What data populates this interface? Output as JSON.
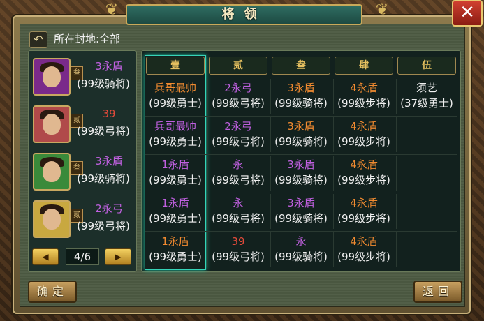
{
  "window": {
    "title": "将领",
    "close_label": "✕"
  },
  "fief": {
    "label": "所在封地:全部"
  },
  "back_arrow": "↶",
  "colors": {
    "purple": "#c060e0",
    "red": "#e04a3a",
    "orange": "#f08a30",
    "gold": "#e6c060",
    "white": "#f0f0f0"
  },
  "generals": [
    {
      "rank": "叁",
      "troops": "3永盾",
      "troops_color": "#c060e0",
      "level": "(99级骑将)",
      "portrait_bg": "#7a2a8a"
    },
    {
      "rank": "贰",
      "troops": "39",
      "troops_color": "#e04a3a",
      "level": "(99级弓将)",
      "portrait_bg": "#b04a4a"
    },
    {
      "rank": "叁",
      "troops": "3永盾",
      "troops_color": "#c060e0",
      "level": "(99级骑将)",
      "portrait_bg": "#3a8a3a"
    },
    {
      "rank": "贰",
      "troops": "2永弓",
      "troops_color": "#c060e0",
      "level": "(99级弓将)",
      "portrait_bg": "#c8a840"
    }
  ],
  "pager": {
    "prev": "◀",
    "next": "▶",
    "text": "4/6"
  },
  "columns": [
    "壹",
    "贰",
    "叁",
    "肆",
    "伍"
  ],
  "grid": [
    [
      {
        "t": "兵哥最帅",
        "c": "#f08a30",
        "l": "(99级勇士)"
      },
      {
        "t": "2永弓",
        "c": "#c060e0",
        "l": "(99级弓将)"
      },
      {
        "t": "3永盾",
        "c": "#f08a30",
        "l": "(99级骑将)"
      },
      {
        "t": "4永盾",
        "c": "#f08a30",
        "l": "(99级步将)"
      },
      {
        "t": "须艺",
        "c": "#f0f0f0",
        "l": "(37级勇士)"
      }
    ],
    [
      {
        "t": "兵哥最帅",
        "c": "#c060e0",
        "l": "(99级勇士)"
      },
      {
        "t": "2永弓",
        "c": "#c060e0",
        "l": "(99级弓将)"
      },
      {
        "t": "3永盾",
        "c": "#f08a30",
        "l": "(99级骑将)"
      },
      {
        "t": "4永盾",
        "c": "#f08a30",
        "l": "(99级步将)"
      },
      {
        "t": "",
        "c": "#f0f0f0",
        "l": ""
      }
    ],
    [
      {
        "t": "1永盾",
        "c": "#c060e0",
        "l": "(99级勇士)"
      },
      {
        "t": "永",
        "c": "#c060e0",
        "l": "(99级弓将)"
      },
      {
        "t": "3永盾",
        "c": "#c060e0",
        "l": "(99级骑将)"
      },
      {
        "t": "4永盾",
        "c": "#f08a30",
        "l": "(99级步将)"
      },
      {
        "t": "",
        "c": "#f0f0f0",
        "l": ""
      }
    ],
    [
      {
        "t": "1永盾",
        "c": "#c060e0",
        "l": "(99级勇士)"
      },
      {
        "t": "永",
        "c": "#c060e0",
        "l": "(99级弓将)"
      },
      {
        "t": "3永盾",
        "c": "#c060e0",
        "l": "(99级骑将)"
      },
      {
        "t": "4永盾",
        "c": "#f08a30",
        "l": "(99级步将)"
      },
      {
        "t": "",
        "c": "#f0f0f0",
        "l": ""
      }
    ],
    [
      {
        "t": "1永盾",
        "c": "#f08a30",
        "l": "(99级勇士)"
      },
      {
        "t": "39",
        "c": "#e04a3a",
        "l": "(99级弓将)"
      },
      {
        "t": "永",
        "c": "#c060e0",
        "l": "(99级骑将)"
      },
      {
        "t": "4永盾",
        "c": "#f08a30",
        "l": "(99级步将)"
      },
      {
        "t": "",
        "c": "#f0f0f0",
        "l": ""
      }
    ]
  ],
  "buttons": {
    "confirm": "确定",
    "back": "返回"
  }
}
